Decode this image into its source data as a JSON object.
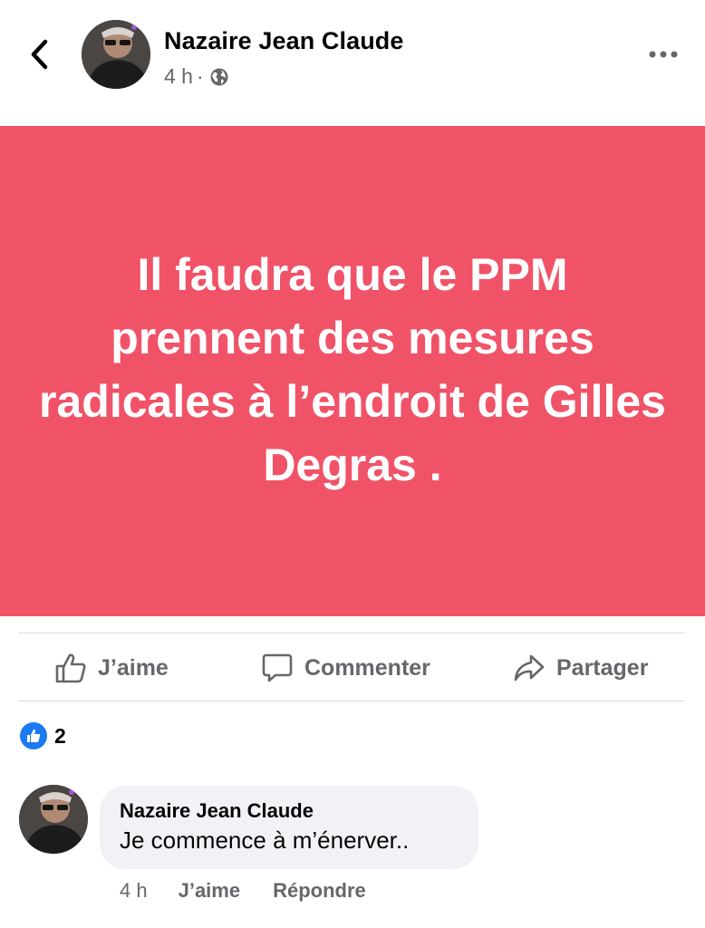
{
  "header": {
    "author_name": "Nazaire Jean Claude",
    "time": "4 h",
    "separator": "·",
    "privacy_icon": "globe-icon",
    "back_icon": "chevron-left-icon",
    "more_icon": "more-horizontal-icon"
  },
  "post": {
    "text": "Il faudra que le PPM prennent des mesures radicales à l’endroit de Gilles Degras .",
    "background_color": "#f05368",
    "text_color": "#ffffff"
  },
  "actions": {
    "like_label": "J’aime",
    "comment_label": "Commenter",
    "share_label": "Partager"
  },
  "reactions": {
    "icon": "like-reaction-icon",
    "count": "2",
    "color": "#1d79f2"
  },
  "comment": {
    "author_name": "Nazaire Jean Claude",
    "text": "Je commence à m’énerver..",
    "time": "4 h",
    "like_label": "J’aime",
    "reply_label": "Répondre"
  }
}
